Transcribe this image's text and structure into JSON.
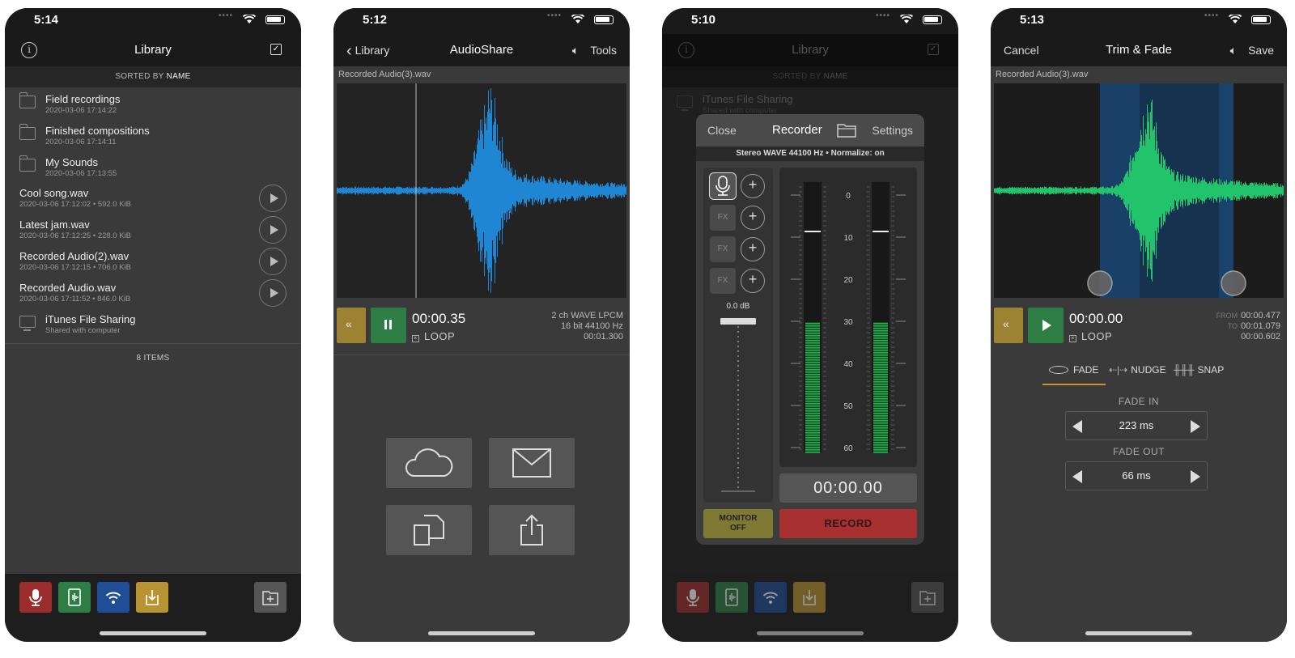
{
  "colors": {
    "accent_orange": "#d09030",
    "red": "#a83030",
    "green": "#2e7d45",
    "blue": "#1f4e96",
    "gold": "#b89332",
    "waveform_blue": "#1f86d4",
    "waveform_green": "#21c46a"
  },
  "screen1": {
    "time": "5:14",
    "title": "Library",
    "sorted_prefix": "SORTED BY",
    "sorted_key": "NAME",
    "folders": [
      {
        "name": "Field recordings",
        "meta": "2020-03-06 17:14:22"
      },
      {
        "name": "Finished compositions",
        "meta": "2020-03-06 17:14:11"
      },
      {
        "name": "My Sounds",
        "meta": "2020-03-06 17:13:55"
      }
    ],
    "files": [
      {
        "name": "Cool song.wav",
        "meta": "2020-03-06 17:12:02 • 592.0 KiB"
      },
      {
        "name": "Latest jam.wav",
        "meta": "2020-03-06 17:12:25 • 228.0 KiB"
      },
      {
        "name": "Recorded Audio(2).wav",
        "meta": "2020-03-06 17:12:15 • 706.0 KiB"
      },
      {
        "name": "Recorded Audio.wav",
        "meta": "2020-03-06 17:11:52 • 846.0 KiB"
      }
    ],
    "itunes": {
      "name": "iTunes File Sharing",
      "meta": "Shared with computer"
    },
    "count": "8 ITEMS"
  },
  "screen2": {
    "time": "5:12",
    "back": "Library",
    "title": "AudioShare",
    "tools": "Tools",
    "file": "Recorded Audio(3).wav",
    "position": "00:00.35",
    "loop": "LOOP",
    "format1": "2 ch WAVE LPCM",
    "format2": "16 bit 44100 Hz",
    "duration": "00:01.300"
  },
  "screen3": {
    "time": "5:10",
    "title": "Library",
    "sorted_prefix": "SORTED BY",
    "sorted_key": "NAME",
    "itunes": {
      "name": "iTunes File Sharing",
      "meta": "Shared with computer"
    },
    "close": "Close",
    "recorder": "Recorder",
    "settings": "Settings",
    "info": "Stereo WAVE 44100 Hz • Normalize: on",
    "fx": "FX",
    "gain": "0.0 dB",
    "scale": [
      "0",
      "10",
      "20",
      "30",
      "40",
      "50",
      "60"
    ],
    "meter_level": 0.48,
    "rec_time": "00:00.00",
    "monitor1": "MONITOR",
    "monitor2": "OFF",
    "record": "RECORD"
  },
  "screen4": {
    "time": "5:13",
    "cancel": "Cancel",
    "title": "Trim & Fade",
    "save": "Save",
    "file": "Recorded Audio(3).wav",
    "position": "00:00.00",
    "loop": "LOOP",
    "from_label": "FROM",
    "from": "00:00.477",
    "to_label": "TO",
    "to": "00:01.079",
    "len": "00:00.602",
    "tabs": [
      "FADE",
      "NUDGE",
      "SNAP"
    ],
    "fade_in_label": "FADE IN",
    "fade_in": "223 ms",
    "fade_out_label": "FADE OUT",
    "fade_out": "66 ms"
  }
}
